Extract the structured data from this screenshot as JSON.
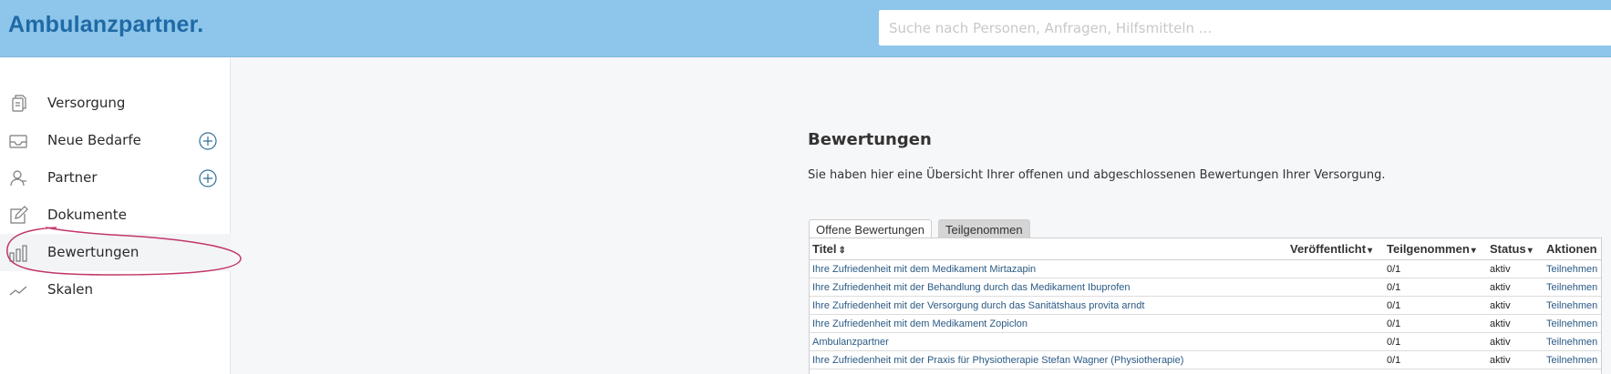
{
  "header": {
    "logo": "Ambulanzpartner.",
    "search_placeholder": "Suche nach Personen, Anfragen, Hilfsmitteln ..."
  },
  "sidebar": {
    "items": [
      {
        "label": "Versorgung",
        "icon": "documents-icon"
      },
      {
        "label": "Neue Bedarfe",
        "icon": "inbox-icon",
        "has_add": true
      },
      {
        "label": "Partner",
        "icon": "person-icon",
        "has_add": true
      },
      {
        "label": "Dokumente",
        "icon": "edit-icon"
      },
      {
        "label": "Bewertungen",
        "icon": "bar-chart-icon",
        "active": true
      },
      {
        "label": "Skalen",
        "icon": "trend-line-icon"
      }
    ]
  },
  "main": {
    "title": "Bewertungen",
    "description": "Sie haben hier eine Übersicht Ihrer offenen und abgeschlossenen Bewertungen Ihrer Versorgung.",
    "tabs": [
      {
        "label": "Offene Bewertungen",
        "active": true
      },
      {
        "label": "Teilgenommen",
        "active": false
      }
    ],
    "table": {
      "columns": [
        {
          "label": "Titel",
          "sort": "both"
        },
        {
          "label": "Veröffentlicht",
          "sort": "down"
        },
        {
          "label": "Teilgenommen",
          "sort": "down"
        },
        {
          "label": "Status",
          "sort": "down"
        },
        {
          "label": "Aktionen",
          "sort": "none"
        }
      ],
      "rows": [
        {
          "title": "Ihre Zufriedenheit mit dem Medikament Mirtazapin",
          "published": "",
          "participated": "0/1",
          "status": "aktiv",
          "action": "Teilnehmen"
        },
        {
          "title": "Ihre Zufriedenheit mit der Behandlung durch das Medikament Ibuprofen",
          "published": "",
          "participated": "0/1",
          "status": "aktiv",
          "action": "Teilnehmen"
        },
        {
          "title": "Ihre Zufriedenheit mit der Versorgung durch das Sanitätshaus provita arndt",
          "published": "",
          "participated": "0/1",
          "status": "aktiv",
          "action": "Teilnehmen"
        },
        {
          "title": "Ihre Zufriedenheit mit dem Medikament Zopiclon",
          "published": "",
          "participated": "0/1",
          "status": "aktiv",
          "action": "Teilnehmen"
        },
        {
          "title": "Ambulanzpartner",
          "published": "",
          "participated": "0/1",
          "status": "aktiv",
          "action": "Teilnehmen"
        },
        {
          "title": "Ihre Zufriedenheit mit der Praxis für Physiotherapie Stefan Wagner (Physiotherapie)",
          "published": "",
          "participated": "0/1",
          "status": "aktiv",
          "action": "Teilnehmen"
        }
      ]
    }
  },
  "colors": {
    "header_bg": "#8ec5ea",
    "logo": "#1f6aa5",
    "link": "#2a5a84",
    "annotation": "#c2366b"
  }
}
